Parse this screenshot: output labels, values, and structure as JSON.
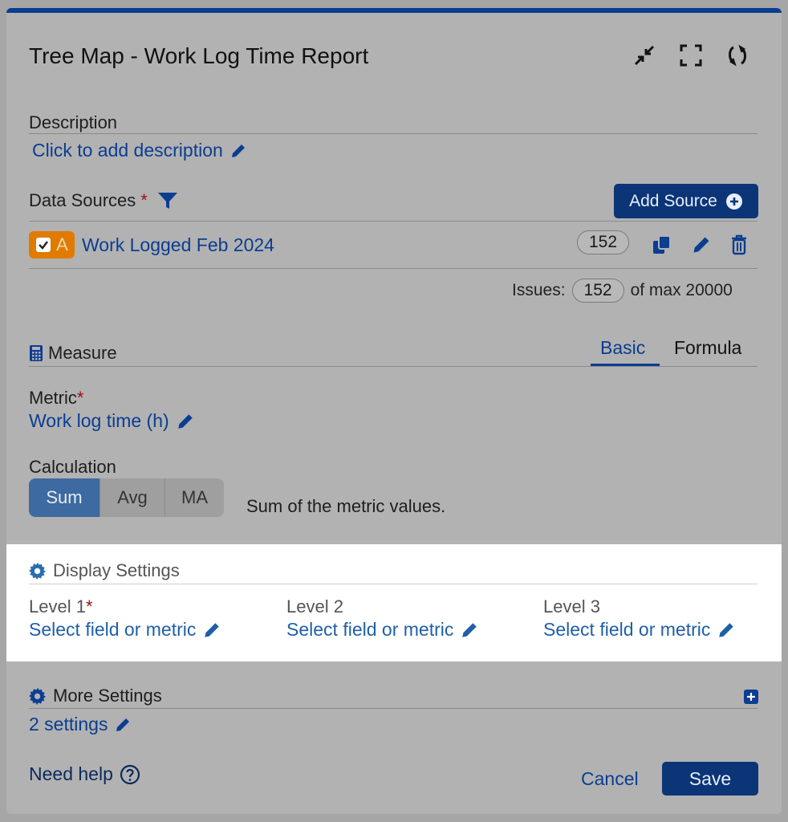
{
  "header": {
    "title": "Tree Map - Work Log Time Report"
  },
  "description": {
    "label": "Description",
    "add_link": "Click to add description"
  },
  "data_sources": {
    "label": "Data Sources",
    "required_mark": "*",
    "add_button": "Add Source",
    "source": {
      "badge_letter": "A",
      "name": "Work Logged Feb 2024",
      "count": "152"
    },
    "issues_label": "Issues:",
    "issues_count": "152",
    "issues_max": "of max 20000"
  },
  "measure": {
    "label": "Measure",
    "tabs": [
      "Basic",
      "Formula"
    ],
    "active_tab": "Basic",
    "metric_label": "Metric",
    "metric_value": "Work log time (h)",
    "calculation_label": "Calculation",
    "calc_options": [
      "Sum",
      "Avg",
      "MA"
    ],
    "calc_selected": "Sum",
    "calc_description": "Sum of the metric values."
  },
  "display_settings": {
    "label": "Display Settings",
    "levels": [
      {
        "label": "Level 1",
        "required": "*",
        "value": "Select field or metric"
      },
      {
        "label": "Level 2",
        "value": "Select field or metric"
      },
      {
        "label": "Level 3",
        "value": "Select field or metric"
      }
    ]
  },
  "more_settings": {
    "label": "More Settings",
    "value": "2 settings"
  },
  "footer": {
    "help": "Need help",
    "cancel": "Cancel",
    "save": "Save"
  },
  "colors": {
    "brand": "#0b3d91",
    "badge": "#e07b00",
    "overlay": "#b2b2b2"
  }
}
